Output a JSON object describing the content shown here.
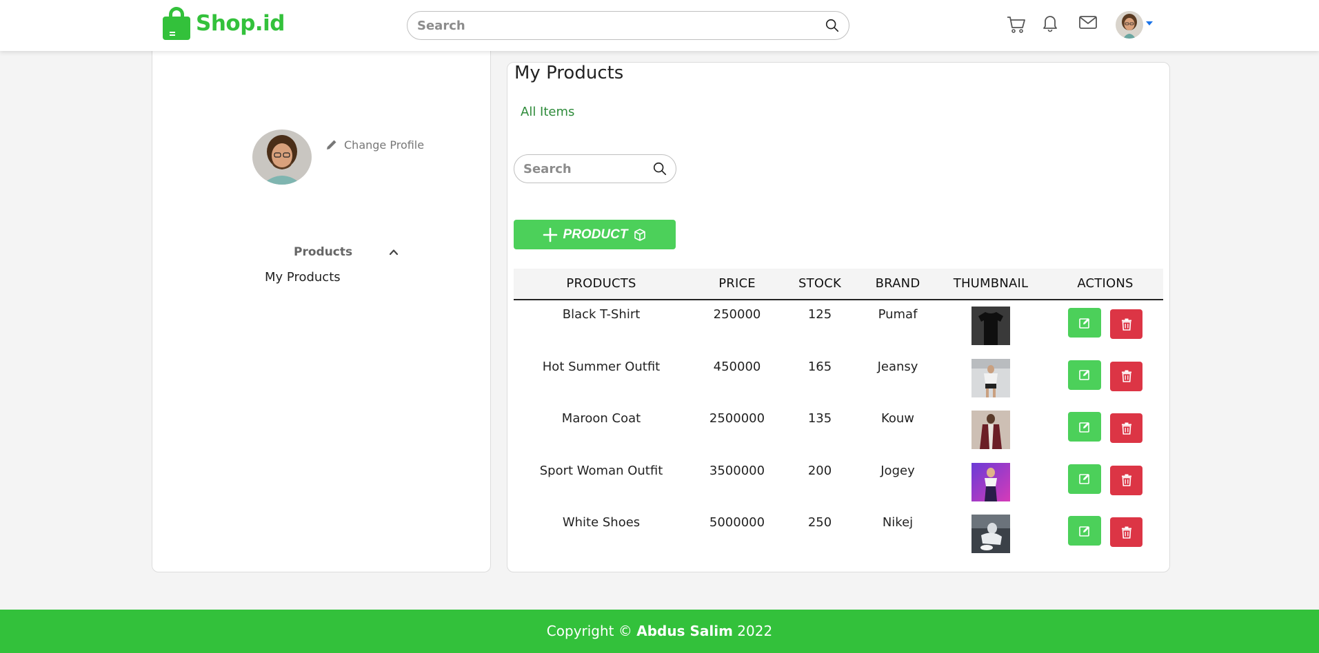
{
  "brand": {
    "name": "Shop.id",
    "color": "#33c13b"
  },
  "header": {
    "search_placeholder": "Search",
    "icons": [
      "cart-icon",
      "bell-icon",
      "mail-icon"
    ]
  },
  "sidebar": {
    "change_profile": "Change Profile",
    "section_label": "Products",
    "items": [
      {
        "label": "My Products"
      }
    ]
  },
  "main": {
    "title": "My Products",
    "tab": "All Items",
    "search_placeholder": "Search",
    "add_button": "PRODUCT"
  },
  "table": {
    "headers": [
      "PRODUCTS",
      "PRICE",
      "STOCK",
      "BRAND",
      "THUMBNAIL",
      "ACTIONS"
    ],
    "rows": [
      {
        "product": "Black T-Shirt",
        "price": "250000",
        "stock": "125",
        "brand": "Pumaf",
        "thumb": "black-tshirt"
      },
      {
        "product": "Hot Summer Outfit",
        "price": "450000",
        "stock": "165",
        "brand": "Jeansy",
        "thumb": "summer-outfit"
      },
      {
        "product": "Maroon Coat",
        "price": "2500000",
        "stock": "135",
        "brand": "Kouw",
        "thumb": "maroon-coat"
      },
      {
        "product": "Sport Woman Outfit",
        "price": "3500000",
        "stock": "200",
        "brand": "Jogey",
        "thumb": "sport-outfit"
      },
      {
        "product": "White Shoes",
        "price": "5000000",
        "stock": "250",
        "brand": "Nikej",
        "thumb": "white-shoes"
      }
    ]
  },
  "footer": {
    "prefix": "Copyright ©",
    "author": "Abdus Salim",
    "year": "2022"
  },
  "colors": {
    "green": "#4cd05a",
    "red": "#dc3545",
    "link_green": "#2e8b3a",
    "caret_blue": "#1a73e8"
  }
}
